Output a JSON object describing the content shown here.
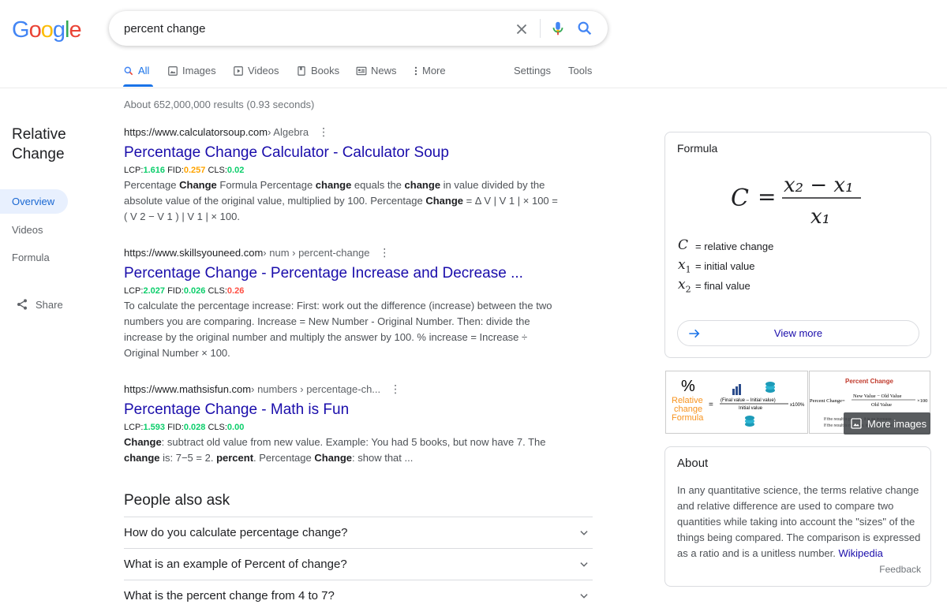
{
  "brand": {
    "logo_letters": [
      "G",
      "o",
      "o",
      "g",
      "l",
      "e"
    ],
    "logo_colors": [
      "#4285f4",
      "#ea4335",
      "#fbbc05",
      "#4285f4",
      "#34a853",
      "#ea4335"
    ]
  },
  "search": {
    "query": "percent change"
  },
  "tabs": [
    {
      "label": "All",
      "icon": "search-icon",
      "active": true
    },
    {
      "label": "Images",
      "icon": "image-icon"
    },
    {
      "label": "Videos",
      "icon": "video-icon"
    },
    {
      "label": "Books",
      "icon": "book-icon"
    },
    {
      "label": "News",
      "icon": "news-icon"
    },
    {
      "label": "More",
      "icon": "more-vert-icon"
    },
    {
      "label": "Settings"
    },
    {
      "label": "Tools"
    }
  ],
  "stats": "About 652,000,000 results (0.93 seconds)",
  "rail": {
    "title": "Relative Change",
    "items": [
      "Overview",
      "Videos",
      "Formula"
    ],
    "share_label": "Share"
  },
  "results": [
    {
      "domain": "https://www.calculatorsoup.com",
      "crumb": " › Algebra",
      "title": "Percentage Change Calculator - Calculator Soup",
      "metrics": {
        "lcp": "1.616",
        "fid": "0.257",
        "cls": "0.02"
      },
      "snippet_html": "Percentage <b>Change</b> Formula Percentage <b>change</b> equals the <b>change</b> in value divided by the absolute value of the original value, multiplied by 100. Percentage <b>Change</b> = Δ V | V 1 | × 100 = ( V 2 − V 1 ) | V 1 | × 100."
    },
    {
      "domain": "https://www.skillsyouneed.com",
      "crumb": " › num › percent-change",
      "title": "Percentage Change - Percentage Increase and Decrease ...",
      "metrics": {
        "lcp": "2.027",
        "fid": "0.026",
        "cls": "0.26"
      },
      "snippet_html": "To calculate the percentage increase: First: work out the difference (increase) between the two numbers you are comparing. Increase = New Number - Original Number. Then: divide the increase by the original number and multiply the answer by 100. % increase = Increase ÷ Original Number × 100."
    },
    {
      "domain": "https://www.mathsisfun.com",
      "crumb": " › numbers › percentage-ch...",
      "title": "Percentage Change - Math is Fun",
      "metrics": {
        "lcp": "1.593",
        "fid": "0.028",
        "cls": "0.00"
      },
      "snippet_html": "<b>Change</b>: subtract old value from new value. Example: You had 5 books, but now have 7. The <b>change</b> is: 7−5 = 2. <b>percent</b>. Percentage <b>Change</b>: show that ..."
    }
  ],
  "metric_labels": {
    "lcp": "LCP:",
    "fid": "FID:",
    "cls": "CLS:"
  },
  "people_also_ask": {
    "title": "People also ask",
    "questions": [
      "How do you calculate percentage change?",
      "What is an example of Percent of change?",
      "What is the percent change from 4 to 7?"
    ]
  },
  "formula_card": {
    "label": "Formula",
    "lhs": "C",
    "numerator": "x₂ − x₁",
    "denominator": "x₁",
    "legend": [
      {
        "symbol": "C",
        "sub": "",
        "text": "= relative change"
      },
      {
        "symbol": "x",
        "sub": "1",
        "text": "= initial value"
      },
      {
        "symbol": "x",
        "sub": "2",
        "text": "= final value"
      }
    ],
    "view_more": "View more"
  },
  "images": {
    "img_a": {
      "percent": "%",
      "words": [
        "Relative",
        "change",
        "Formula"
      ],
      "eq_top": "(Final value – Initial value)",
      "eq_bottom": "Initial value",
      "multiplier": "x100%"
    },
    "img_b": {
      "title": "Percent Change",
      "lhs": "Percent Change=",
      "top": "New Value − Old Value",
      "bottom": "Old Value",
      "mult": "×100",
      "fine1": "If the result is positive, it is an increase.",
      "fine2": "If the result is negative, it is a decrease."
    },
    "more_images": "More images"
  },
  "about_card": {
    "label": "About",
    "text": "In any quantitative science, the terms relative change and relative difference are used to compare two quantities while taking into account the \"sizes\" of the things being compared. The comparison is expressed as a ratio and is a unitless number. ",
    "link": "Wikipedia",
    "feedback": "Feedback"
  }
}
